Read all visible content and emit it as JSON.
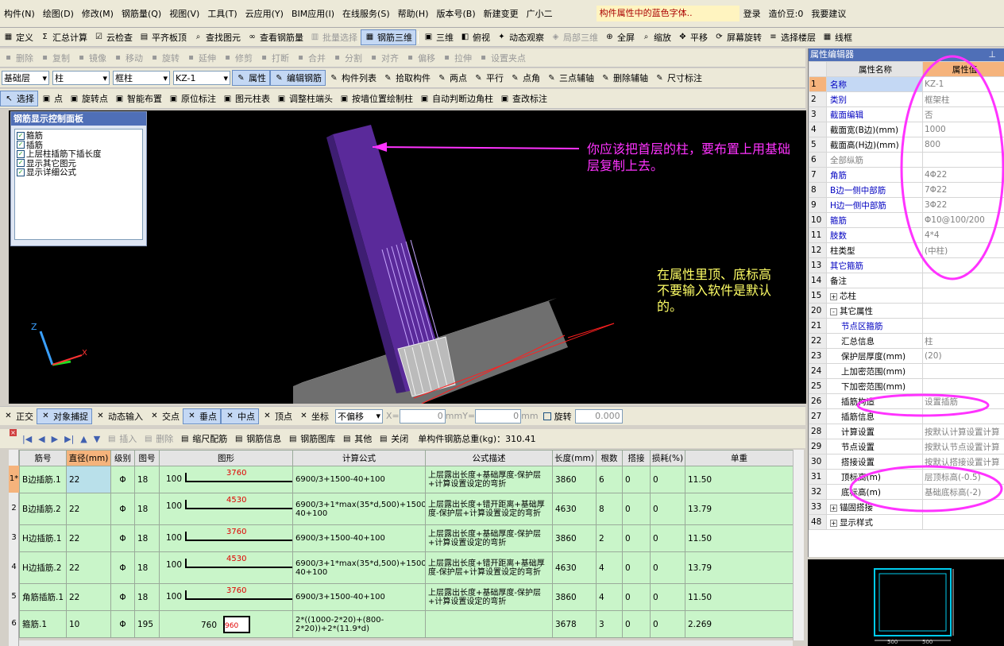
{
  "menu": [
    "构件(N)",
    "绘图(D)",
    "修改(M)",
    "钢筋量(Q)",
    "视图(V)",
    "工具(T)",
    "云应用(Y)",
    "BIM应用(I)",
    "在线服务(S)",
    "帮助(H)",
    "版本号(B)",
    "新建变更",
    "广小二"
  ],
  "notice": "构件属性中的蓝色字体..",
  "account": {
    "login": "登录",
    "beans": "造价豆:0",
    "advice": "我要建议"
  },
  "toolbar1": [
    "定义",
    "汇总计算",
    "云检查",
    "平齐板顶",
    "查找图元",
    "查看钢筋量",
    "批量选择",
    "钢筋三维",
    "三维",
    "俯视",
    "动态观察",
    "局部三维",
    "全屏",
    "缩放",
    "平移",
    "屏幕旋转",
    "选择楼层",
    "线框"
  ],
  "toolbar2": [
    "删除",
    "复制",
    "镜像",
    "移动",
    "旋转",
    "延伸",
    "修剪",
    "打断",
    "合并",
    "分割",
    "对齐",
    "偏移",
    "拉伸",
    "设置夹点"
  ],
  "toolbar3": {
    "floor": "基础层",
    "type": "柱",
    "subtype": "框柱",
    "name": "KZ-1",
    "buttons": [
      "属性",
      "编辑钢筋",
      "构件列表",
      "拾取构件",
      "两点",
      "平行",
      "点角",
      "三点辅轴",
      "删除辅轴",
      "尺寸标注"
    ]
  },
  "toolbar4": [
    "选择",
    "点",
    "旋转点",
    "智能布置",
    "原位标注",
    "图元柱表",
    "调整柱端头",
    "按墙位置绘制柱",
    "自动判断边角柱",
    "查改标注"
  ],
  "control_panel": {
    "title": "钢筋显示控制面板",
    "items": [
      "箍筋",
      "插筋",
      "上层柱插筋下插长度",
      "显示其它图元",
      "显示详细公式"
    ]
  },
  "annotations": {
    "top": "你应该把首层的柱，要布置上用基础层复制上去。",
    "bottom": "在属性里顶、底标高不要输入软件是默认的。"
  },
  "axes": {
    "z": "Z",
    "x": "X"
  },
  "snap_bar": {
    "items": [
      "正交",
      "对象捕捉",
      "动态输入",
      "交点",
      "垂点",
      "中点",
      "顶点",
      "坐标"
    ],
    "offset": "不偏移",
    "x_label": "X=",
    "x_val": "0",
    "y_label": "Y=",
    "y_val": "0",
    "unit": "mm",
    "rotate": "旋转",
    "rotate_val": "0.000"
  },
  "rebar_bar": {
    "items": [
      "插入",
      "删除",
      "缩尺配筋",
      "钢筋信息",
      "钢筋图库",
      "其他",
      "关闭"
    ],
    "total": "单构件钢筋总重(kg)：310.41"
  },
  "grid": {
    "headers": [
      "筋号",
      "直径(mm)",
      "级别",
      "图号",
      "图形",
      "计算公式",
      "公式描述",
      "长度(mm)",
      "根数",
      "搭接",
      "损耗(%)",
      "单重"
    ],
    "rows": [
      {
        "idx": "1*",
        "name": "B边插筋.1",
        "dia": "22",
        "grade": "Φ",
        "fig": "18",
        "left": "100",
        "len_fig": "3760",
        "formula": "6900/3+1500-40+100",
        "desc": "上层露出长度+基础厚度-保护层+计算设置设定的弯折",
        "length": "3860",
        "count": "6",
        "lap": "0",
        "loss": "0",
        "weight": "11.50"
      },
      {
        "idx": "2",
        "name": "B边插筋.2",
        "dia": "22",
        "grade": "Φ",
        "fig": "18",
        "left": "100",
        "len_fig": "4530",
        "formula": "6900/3+1*max(35*d,500)+1500-40+100",
        "desc": "上层露出长度+错开距离+基础厚度-保护层+计算设置设定的弯折",
        "length": "4630",
        "count": "8",
        "lap": "0",
        "loss": "0",
        "weight": "13.79"
      },
      {
        "idx": "3",
        "name": "H边插筋.1",
        "dia": "22",
        "grade": "Φ",
        "fig": "18",
        "left": "100",
        "len_fig": "3760",
        "formula": "6900/3+1500-40+100",
        "desc": "上层露出长度+基础厚度-保护层+计算设置设定的弯折",
        "length": "3860",
        "count": "2",
        "lap": "0",
        "loss": "0",
        "weight": "11.50"
      },
      {
        "idx": "4",
        "name": "H边插筋.2",
        "dia": "22",
        "grade": "Φ",
        "fig": "18",
        "left": "100",
        "len_fig": "4530",
        "formula": "6900/3+1*max(35*d,500)+1500-40+100",
        "desc": "上层露出长度+错开距离+基础厚度-保护层+计算设置设定的弯折",
        "length": "4630",
        "count": "4",
        "lap": "0",
        "loss": "0",
        "weight": "13.79"
      },
      {
        "idx": "5",
        "name": "角筋插筋.1",
        "dia": "22",
        "grade": "Φ",
        "fig": "18",
        "left": "100",
        "len_fig": "3760",
        "formula": "6900/3+1500-40+100",
        "desc": "上层露出长度+基础厚度-保护层+计算设置设定的弯折",
        "length": "3860",
        "count": "4",
        "lap": "0",
        "loss": "0",
        "weight": "11.50"
      },
      {
        "idx": "6",
        "name": "箍筋.1",
        "dia": "10",
        "grade": "Φ",
        "fig": "195",
        "left": "760",
        "len_fig": "960",
        "formula": "2*((1000-2*20)+(800-2*20))+2*(11.9*d)",
        "desc": "",
        "length": "3678",
        "count": "3",
        "lap": "0",
        "loss": "0",
        "weight": "2.269"
      }
    ]
  },
  "props": {
    "title": "属性编辑器",
    "headers": [
      "属性名称",
      "属性值"
    ],
    "rows": [
      {
        "n": "1",
        "name": "名称",
        "val": "KZ-1",
        "cls": "blue"
      },
      {
        "n": "2",
        "name": "类别",
        "val": "框架柱",
        "cls": "blue"
      },
      {
        "n": "3",
        "name": "截面编辑",
        "val": "否",
        "cls": "blue"
      },
      {
        "n": "4",
        "name": "截面宽(B边)(mm)",
        "val": "1000",
        "cls": ""
      },
      {
        "n": "5",
        "name": "截面高(H边)(mm)",
        "val": "800",
        "cls": ""
      },
      {
        "n": "6",
        "name": "全部纵筋",
        "val": "",
        "cls": "gray"
      },
      {
        "n": "7",
        "name": "角筋",
        "val": "4Φ22",
        "cls": "blue"
      },
      {
        "n": "8",
        "name": "B边一侧中部筋",
        "val": "7Φ22",
        "cls": "blue"
      },
      {
        "n": "9",
        "name": "H边一侧中部筋",
        "val": "3Φ22",
        "cls": "blue"
      },
      {
        "n": "10",
        "name": "箍筋",
        "val": "Φ10@100/200",
        "cls": "blue"
      },
      {
        "n": "11",
        "name": "肢数",
        "val": "4*4",
        "cls": "blue"
      },
      {
        "n": "12",
        "name": "柱类型",
        "val": "(中柱)",
        "cls": ""
      },
      {
        "n": "13",
        "name": "其它箍筋",
        "val": "",
        "cls": "blue"
      },
      {
        "n": "14",
        "name": "备注",
        "val": "",
        "cls": ""
      },
      {
        "n": "15",
        "name": "芯柱",
        "val": "",
        "cls": "",
        "tree": "+"
      },
      {
        "n": "20",
        "name": "其它属性",
        "val": "",
        "cls": "",
        "tree": "-"
      },
      {
        "n": "21",
        "name": "节点区箍筋",
        "val": "",
        "cls": "blue",
        "indent": true
      },
      {
        "n": "22",
        "name": "汇总信息",
        "val": "柱",
        "cls": "",
        "indent": true
      },
      {
        "n": "23",
        "name": "保护层厚度(mm)",
        "val": "(20)",
        "cls": "",
        "indent": true
      },
      {
        "n": "24",
        "name": "上加密范围(mm)",
        "val": "",
        "cls": "",
        "indent": true
      },
      {
        "n": "25",
        "name": "下加密范围(mm)",
        "val": "",
        "cls": "",
        "indent": true
      },
      {
        "n": "26",
        "name": "插筋构造",
        "val": "设置插筋",
        "cls": "",
        "indent": true
      },
      {
        "n": "27",
        "name": "插筋信息",
        "val": "",
        "cls": "",
        "indent": true
      },
      {
        "n": "28",
        "name": "计算设置",
        "val": "按默认计算设置计算",
        "cls": "",
        "indent": true
      },
      {
        "n": "29",
        "name": "节点设置",
        "val": "按默认节点设置计算",
        "cls": "",
        "indent": true
      },
      {
        "n": "30",
        "name": "搭接设置",
        "val": "按默认搭接设置计算",
        "cls": "",
        "indent": true
      },
      {
        "n": "31",
        "name": "顶标高(m)",
        "val": "层顶标高(-0.5)",
        "cls": "",
        "indent": true
      },
      {
        "n": "32",
        "name": "底标高(m)",
        "val": "基础底标高(-2)",
        "cls": "",
        "indent": true
      },
      {
        "n": "33",
        "name": "锚固搭接",
        "val": "",
        "cls": "",
        "tree": "+"
      },
      {
        "n": "48",
        "name": "显示样式",
        "val": "",
        "cls": "",
        "tree": "+"
      }
    ]
  },
  "section": {
    "dim1": "500",
    "dim2": "500"
  }
}
